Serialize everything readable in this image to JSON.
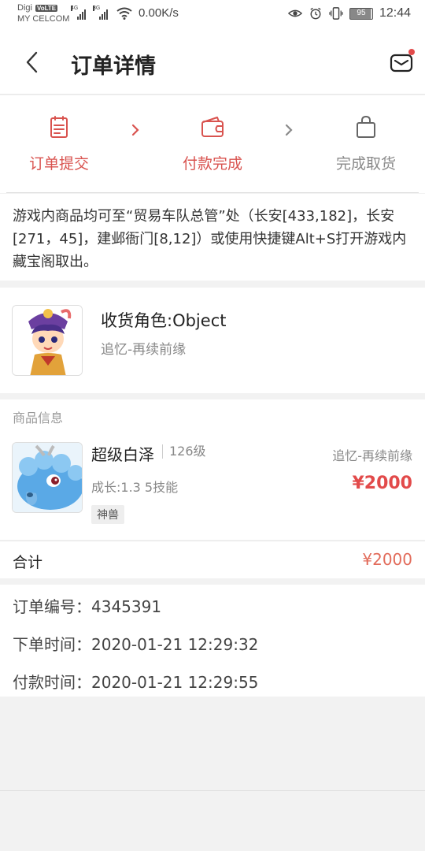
{
  "status_bar": {
    "carrier_line1": "Digi",
    "volte_badge": "VoLTE",
    "carrier_line2": "MY CELCOM",
    "sim1_tag": "4G",
    "sim2_tag": "3G",
    "net_speed": "0.00K/s",
    "battery_level": "95",
    "time": "12:44"
  },
  "header": {
    "title": "订单详情",
    "has_unread_dot": true
  },
  "steps": [
    {
      "label": "订单提交",
      "icon": "clipboard-icon",
      "active": true
    },
    {
      "label": "付款完成",
      "icon": "wallet-icon",
      "active": true
    },
    {
      "label": "完成取货",
      "icon": "bag-icon",
      "active": false
    }
  ],
  "notice": {
    "text": "游戏内商品均可至“贸易车队总管”处（长安[433,182]，长安[271，45]，建邺衙门[8,12]）或使用快捷键Alt+S打开游戏内藏宝阁取出。"
  },
  "receiver": {
    "title": "收货角色:Object",
    "server": "追忆-再续前缘"
  },
  "goods": {
    "heading": "商品信息",
    "name": "超级白泽",
    "level": "126级",
    "server": "追忆-再续前缘",
    "growth": "成长:1.3 5技能",
    "price": "¥2000",
    "tag": "神兽"
  },
  "total": {
    "label": "合计",
    "value": "¥2000"
  },
  "order_info": {
    "order_no": "订单编号：4345391",
    "order_time": "下单时间：2020-01-21 12:29:32",
    "pay_time": "付款时间：2020-01-21 12:29:55"
  },
  "colors": {
    "accent": "#e24a4a",
    "active_step": "#d9534f",
    "inactive_step": "#8a8a8a"
  }
}
